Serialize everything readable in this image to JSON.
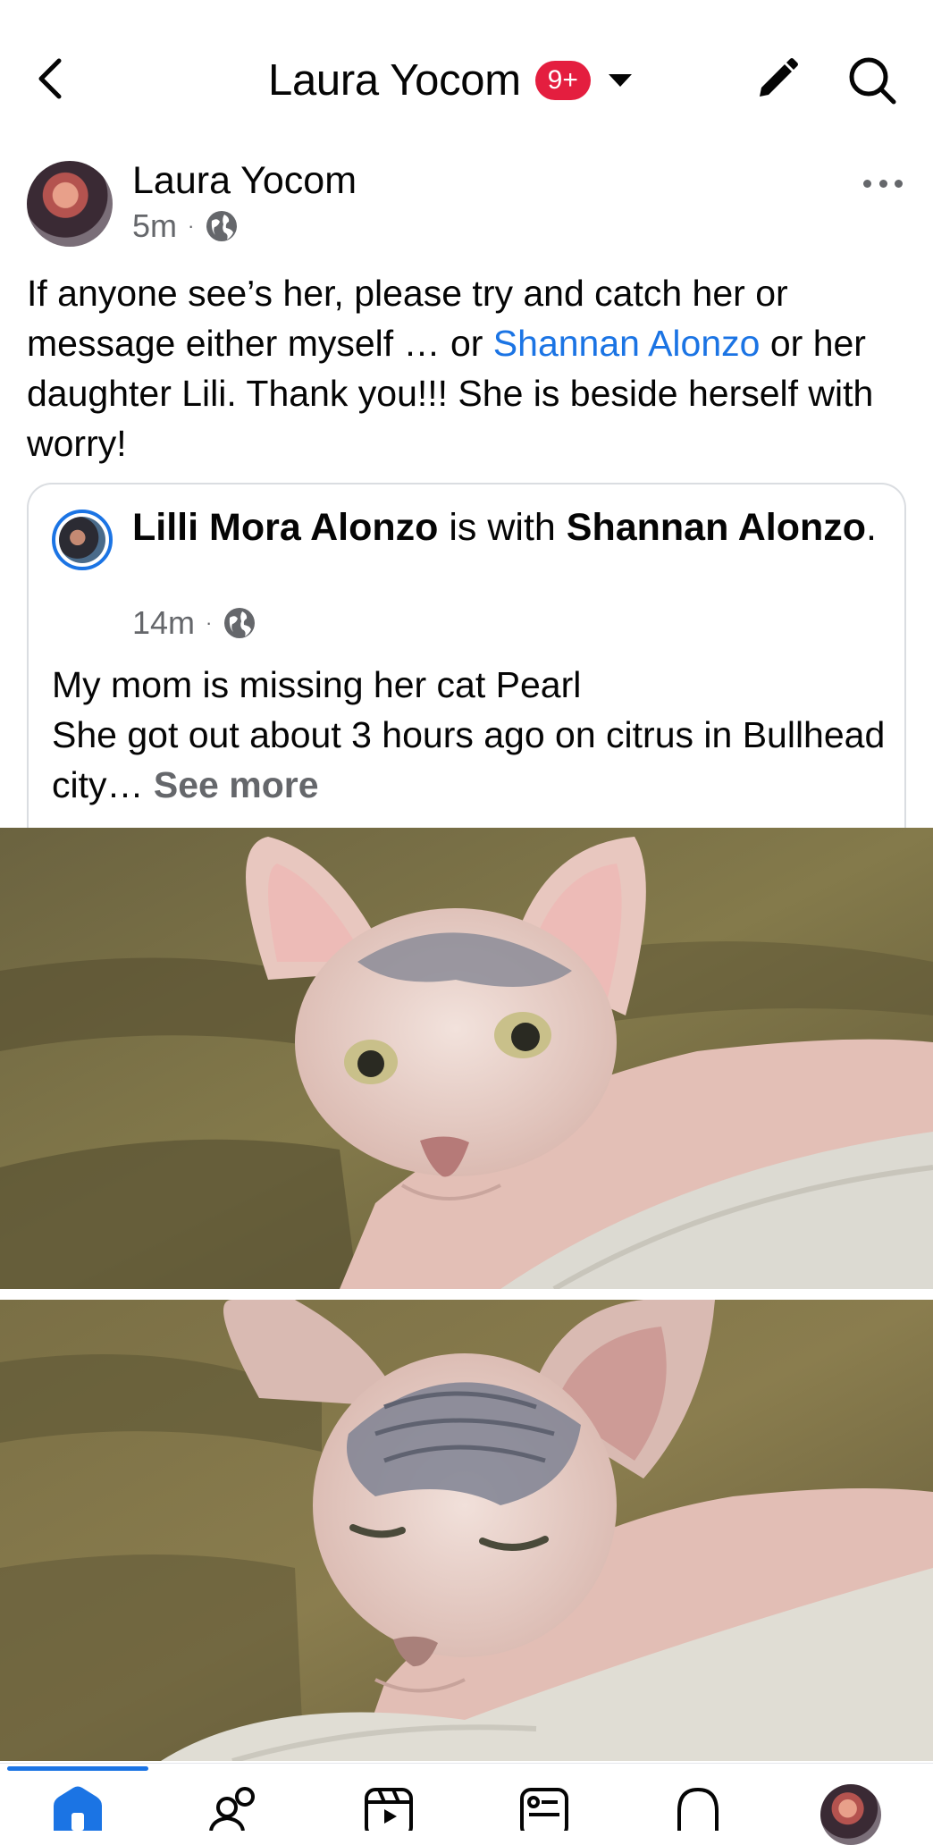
{
  "header": {
    "title": "Laura Yocom",
    "badge": "9+"
  },
  "post": {
    "author": "Laura Yocom",
    "time": "5m",
    "separator": "·",
    "text_part1": "If anyone see’s her, please try and catch her or message either myself … or ",
    "mention": "Shannan Alonzo",
    "text_part2": " or her daughter Lili. Thank you!!! She is beside herself with worry!"
  },
  "shared": {
    "author": "Lilli Mora Alonzo",
    "with_text": " is with ",
    "with_name": "Shannan Alonzo",
    "period": ".",
    "time": "14m",
    "separator": "·",
    "line1": "My mom is missing her cat Pearl",
    "line2": "She got out about 3 hours ago on citrus in Bullhead city… ",
    "see_more": "See more"
  },
  "photos": [
    "cat-photo-1",
    "cat-photo-2"
  ],
  "nav": {
    "items": [
      "home-icon",
      "friends-icon",
      "video-icon",
      "marketplace-icon",
      "notifications-icon",
      "profile-avatar"
    ],
    "active": "home"
  },
  "colors": {
    "link": "#1b74e4",
    "badge": "#e41e3f",
    "secondary_text": "#65676b"
  }
}
